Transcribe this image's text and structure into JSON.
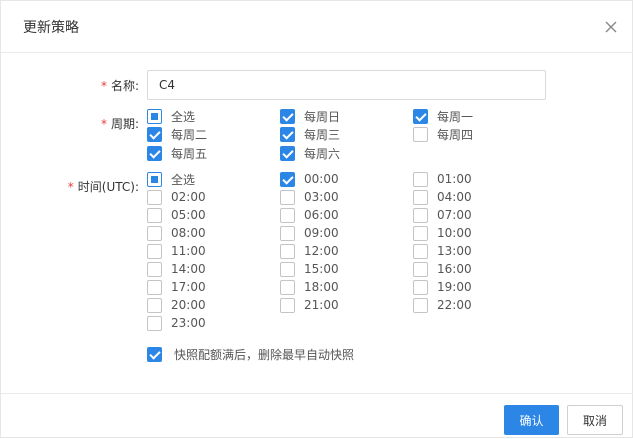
{
  "dialog": {
    "title": "更新策略",
    "close_icon": "close-icon"
  },
  "form": {
    "name": {
      "label": "名称:",
      "required_mark": "*",
      "value": "C4"
    },
    "period": {
      "label": "周期:",
      "required_mark": "*",
      "options": [
        {
          "label": "全选",
          "state": "partial"
        },
        {
          "label": "每周日",
          "state": "checked"
        },
        {
          "label": "每周一",
          "state": "checked"
        },
        {
          "label": "每周二",
          "state": "checked"
        },
        {
          "label": "每周三",
          "state": "checked"
        },
        {
          "label": "每周四",
          "state": "unchecked"
        },
        {
          "label": "每周五",
          "state": "checked"
        },
        {
          "label": "每周六",
          "state": "checked"
        }
      ]
    },
    "time": {
      "label": "时间(UTC):",
      "required_mark": "*",
      "options": [
        {
          "label": "全选",
          "state": "partial"
        },
        {
          "label": "00:00",
          "state": "checked"
        },
        {
          "label": "01:00",
          "state": "unchecked"
        },
        {
          "label": "02:00",
          "state": "unchecked"
        },
        {
          "label": "03:00",
          "state": "unchecked"
        },
        {
          "label": "04:00",
          "state": "unchecked"
        },
        {
          "label": "05:00",
          "state": "unchecked"
        },
        {
          "label": "06:00",
          "state": "unchecked"
        },
        {
          "label": "07:00",
          "state": "unchecked"
        },
        {
          "label": "08:00",
          "state": "unchecked"
        },
        {
          "label": "09:00",
          "state": "unchecked"
        },
        {
          "label": "10:00",
          "state": "unchecked"
        },
        {
          "label": "11:00",
          "state": "unchecked"
        },
        {
          "label": "12:00",
          "state": "unchecked"
        },
        {
          "label": "13:00",
          "state": "unchecked"
        },
        {
          "label": "14:00",
          "state": "unchecked"
        },
        {
          "label": "15:00",
          "state": "unchecked"
        },
        {
          "label": "16:00",
          "state": "unchecked"
        },
        {
          "label": "17:00",
          "state": "unchecked"
        },
        {
          "label": "18:00",
          "state": "unchecked"
        },
        {
          "label": "19:00",
          "state": "unchecked"
        },
        {
          "label": "20:00",
          "state": "unchecked"
        },
        {
          "label": "21:00",
          "state": "unchecked"
        },
        {
          "label": "22:00",
          "state": "unchecked"
        },
        {
          "label": "23:00",
          "state": "unchecked"
        }
      ]
    },
    "auto_delete": {
      "label": "快照配额满后，删除最早自动快照",
      "state": "checked"
    }
  },
  "footer": {
    "confirm_label": "确认",
    "cancel_label": "取消"
  },
  "colors": {
    "accent": "#2b86e6",
    "required": "#e83e3e"
  }
}
